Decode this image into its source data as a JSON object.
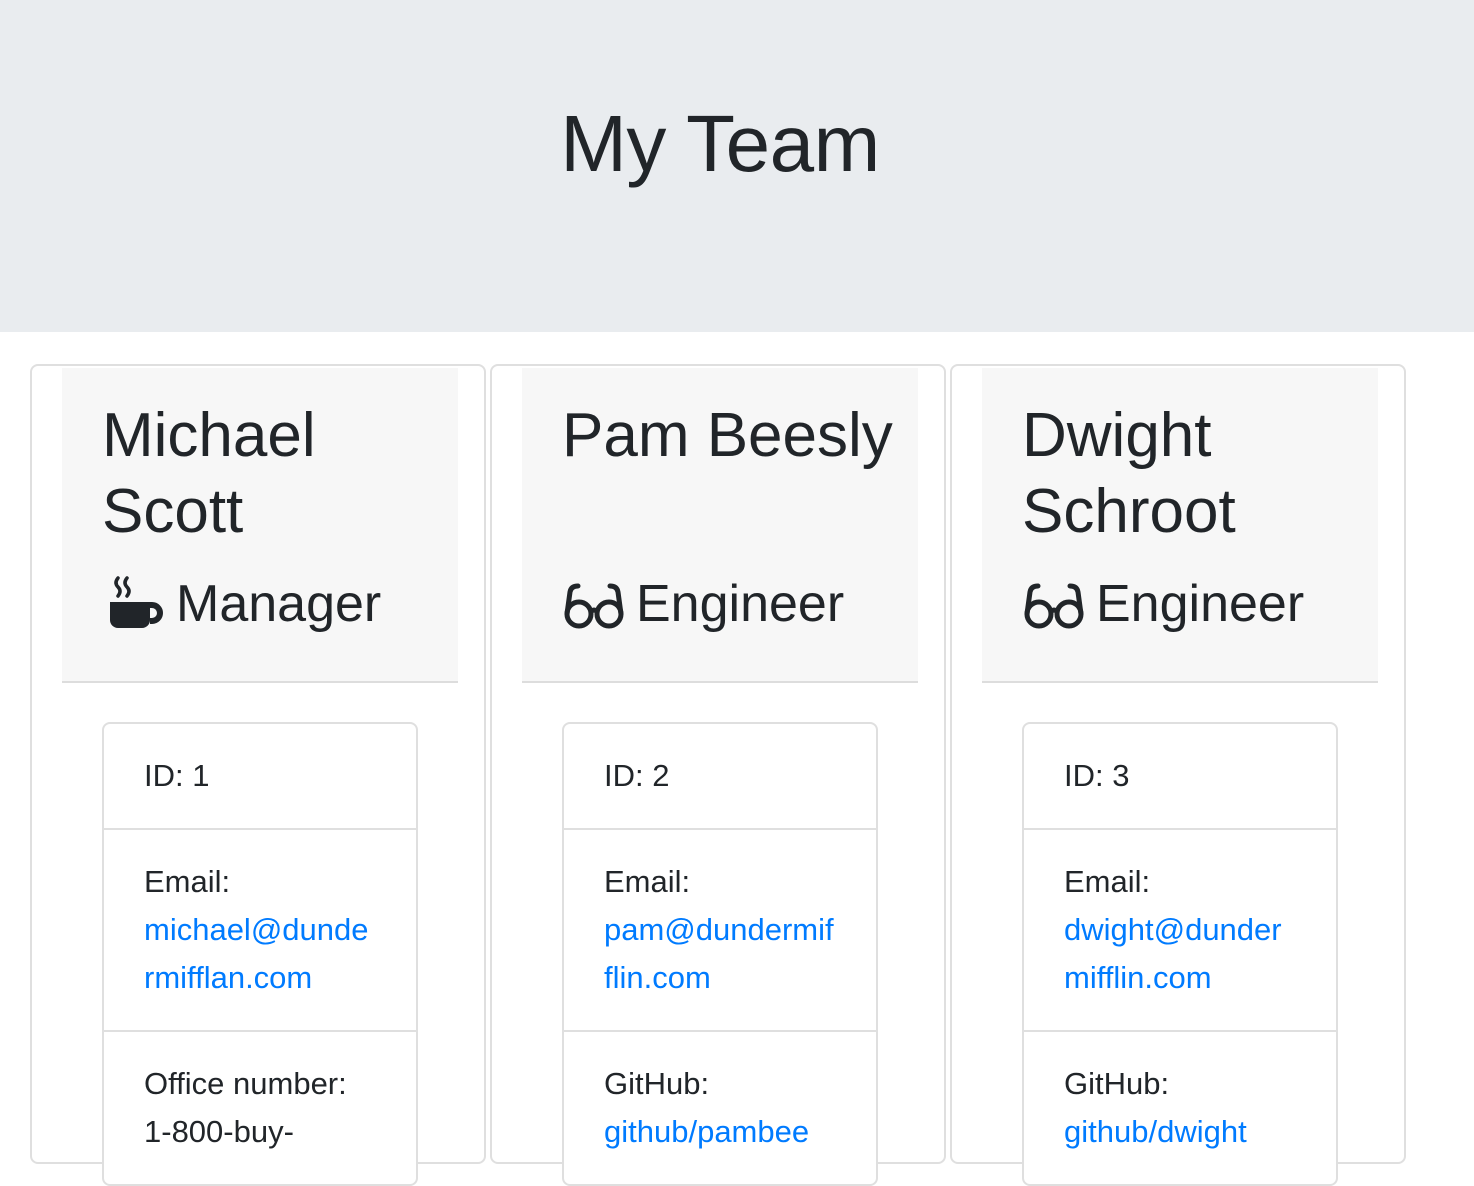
{
  "header": {
    "title": "My Team"
  },
  "members": [
    {
      "name": "Michael Scott",
      "role": "Manager",
      "icon": "coffee-icon",
      "id_text": "ID: 1",
      "email_label": "Email:",
      "email": "michael@dundermifflan.com",
      "extra_label": "Office number:",
      "extra_value": "1-800-buy-"
    },
    {
      "name": "Pam Beesly",
      "role": "Engineer",
      "icon": "glasses-icon",
      "id_text": "ID: 2",
      "email_label": "Email:",
      "email": "pam@dundermifflin.com",
      "extra_label": "GitHub:",
      "extra_value": "github/pambee"
    },
    {
      "name": "Dwight Schroot",
      "role": "Engineer",
      "icon": "glasses-icon",
      "id_text": "ID: 3",
      "email_label": "Email:",
      "email": "dwight@dundermifflin.com",
      "extra_label": "GitHub:",
      "extra_value": "github/dwight"
    }
  ],
  "colors": {
    "jumbotron": "#e9ecef",
    "link": "#007bff",
    "card_header": "#f7f7f7"
  }
}
